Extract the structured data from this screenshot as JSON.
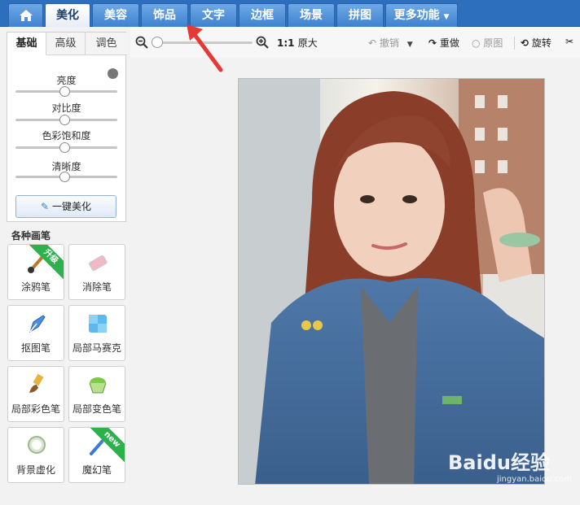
{
  "nav": {
    "home_label": "",
    "tabs": [
      {
        "label": "美化"
      },
      {
        "label": "美容"
      },
      {
        "label": "饰品"
      },
      {
        "label": "文字"
      },
      {
        "label": "边框"
      },
      {
        "label": "场景"
      },
      {
        "label": "拼图"
      },
      {
        "label": "更多功能"
      }
    ]
  },
  "toolbar": {
    "zoom_ratio": "1:1",
    "original_size": "原大",
    "undo": "撤销",
    "redo": "重做",
    "original": "原图",
    "rotate": "旋转",
    "zoom_level": 0.0
  },
  "adjust": {
    "tabs": [
      "基础",
      "高级",
      "调色"
    ],
    "sliders": [
      {
        "label": "亮度",
        "value": 0.5
      },
      {
        "label": "对比度",
        "value": 0.5
      },
      {
        "label": "色彩饱和度",
        "value": 0.5
      },
      {
        "label": "清晰度",
        "value": 0.5
      }
    ],
    "one_click": "一键美化"
  },
  "brushes": {
    "title": "各种画笔",
    "items": [
      {
        "label": "涂鸦笔",
        "badge": "升级"
      },
      {
        "label": "消除笔",
        "badge": ""
      },
      {
        "label": "抠图笔",
        "badge": ""
      },
      {
        "label": "局部马赛克",
        "badge": ""
      },
      {
        "label": "局部彩色笔",
        "badge": ""
      },
      {
        "label": "局部变色笔",
        "badge": ""
      },
      {
        "label": "背景虚化",
        "badge": ""
      },
      {
        "label": "魔幻笔",
        "badge": "new"
      }
    ]
  },
  "watermark": {
    "brand": "Baidu经验",
    "url": "jingyan.baidu.com"
  },
  "colors": {
    "nav_bg": "#2e6fbd",
    "active_tab": "#ffffff",
    "ribbon": "#2db14d",
    "arrow": "#e53935"
  }
}
